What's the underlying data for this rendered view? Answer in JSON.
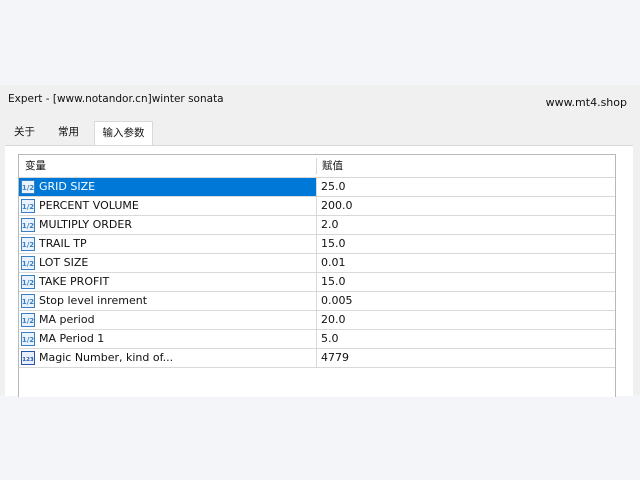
{
  "window": {
    "title": "Expert - [www.notandor.cn]winter sonata",
    "watermark": "www.mt4.shop"
  },
  "tabs": [
    {
      "label": "关于",
      "active": false
    },
    {
      "label": "常用",
      "active": false
    },
    {
      "label": "输入参数",
      "active": true
    }
  ],
  "table": {
    "columns": [
      "变量",
      "赋值"
    ],
    "rows": [
      {
        "name": "GRID SIZE",
        "value": "25.0",
        "type_icon": "double-type-icon",
        "icon_text": "1/2",
        "selected": true
      },
      {
        "name": "PERCENT VOLUME",
        "value": "200.0",
        "type_icon": "double-type-icon",
        "icon_text": "1/2"
      },
      {
        "name": "MULTIPLY ORDER",
        "value": "2.0",
        "type_icon": "double-type-icon",
        "icon_text": "1/2"
      },
      {
        "name": "TRAIL TP",
        "value": "15.0",
        "type_icon": "double-type-icon",
        "icon_text": "1/2"
      },
      {
        "name": "LOT SIZE",
        "value": "0.01",
        "type_icon": "double-type-icon",
        "icon_text": "1/2"
      },
      {
        "name": "TAKE PROFIT",
        "value": "15.0",
        "type_icon": "double-type-icon",
        "icon_text": "1/2"
      },
      {
        "name": "Stop level inrement",
        "value": "0.005",
        "type_icon": "double-type-icon",
        "icon_text": "1/2"
      },
      {
        "name": "MA period",
        "value": "20.0",
        "type_icon": "double-type-icon",
        "icon_text": "1/2"
      },
      {
        "name": "MA Period 1",
        "value": "5.0",
        "type_icon": "double-type-icon",
        "icon_text": "1/2"
      },
      {
        "name": "Magic Number, kind of...",
        "value": "4779",
        "type_icon": "integer-type-icon",
        "icon_text": "123"
      }
    ]
  },
  "colors": {
    "selection": "#0078d7",
    "icon_double": "#3a7fc4",
    "icon_integer": "#2a55a8"
  }
}
